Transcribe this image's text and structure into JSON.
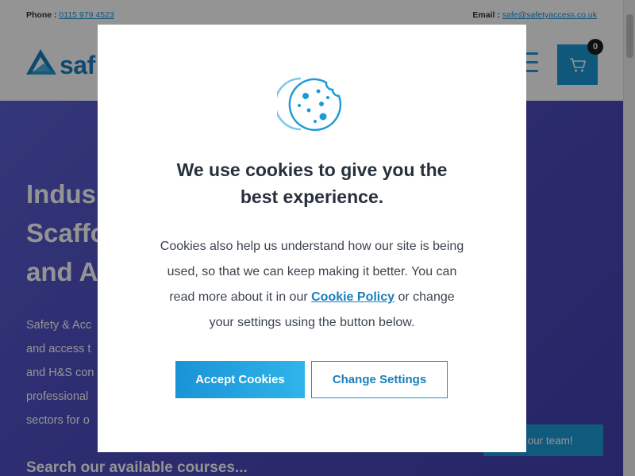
{
  "topbar": {
    "phone_label": "Phone :",
    "phone_number": "0115 979 4523",
    "email_label": "Email :",
    "email_address": "safe@safetyaccess.co.uk"
  },
  "header": {
    "logo_text": "saf",
    "cart_count": "0",
    "icons": {
      "menu": "hamburger-menu-icon",
      "cart": "shopping-cart-icon"
    }
  },
  "hero": {
    "title_lines": [
      "Indus",
      "Scaffo",
      "and A"
    ],
    "text_lines": [
      "Safety & Acc",
      "and access t",
      "and H&S con",
      "professional",
      "sectors for o"
    ],
    "call_button": "all our team!",
    "search_heading": "Search our available courses..."
  },
  "cookie_modal": {
    "title_line1": "We use cookies to give you the",
    "title_line2": "best experience.",
    "body_line1": "Cookies also help us understand how our site is being",
    "body_line2": "used, so that we can keep making it better. You can",
    "body_line3_pre": "read more about it in our ",
    "policy_link": "Cookie Policy",
    "body_line3_post": " or change",
    "body_line4": "your settings using the button below.",
    "accept_button": "Accept Cookies",
    "settings_button": "Change Settings"
  },
  "colors": {
    "accent": "#1b98d6",
    "hero_bg": "#4c4cc0",
    "title_text": "#26303c"
  }
}
